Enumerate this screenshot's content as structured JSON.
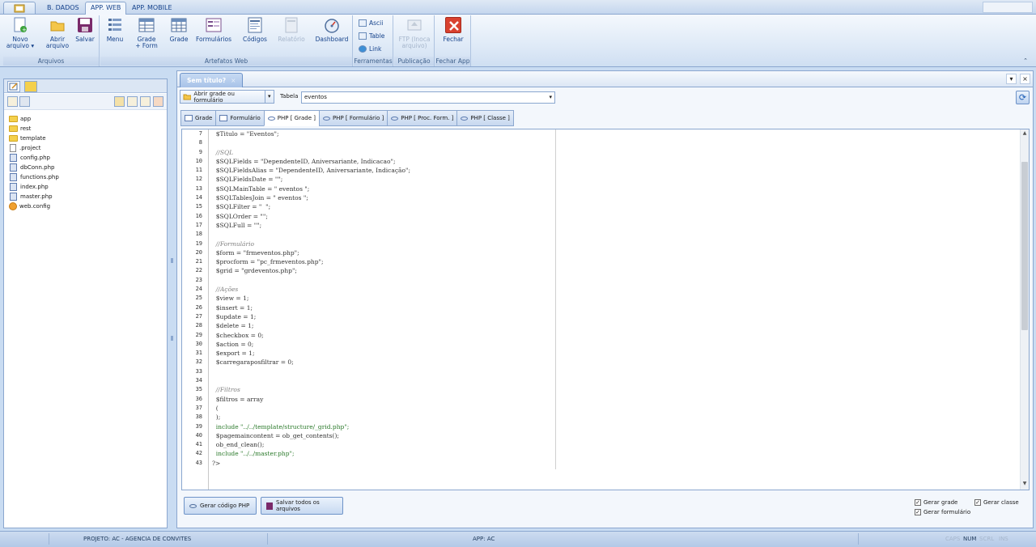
{
  "ribbon_tabs": [
    "B. DADOS",
    "APP. WEB",
    "APP. MOBILE"
  ],
  "active_ribbon_tab": "APP. WEB",
  "groups": {
    "arquivos": {
      "label": "Arquivos",
      "novo": "Novo",
      "novo_sub": "arquivo ▾",
      "abrir": "Abrir",
      "abrir_sub": "arquivo",
      "salvar": "Salvar"
    },
    "artefatos": {
      "label": "Artefatos Web",
      "menu": "Menu",
      "grade_form": "Grade",
      "grade_form_sub": "+ Form",
      "grade": "Grade",
      "formularios": "Formulários",
      "codigos": "Códigos",
      "relatorio": "Relatório",
      "dashboard": "Dashboard"
    },
    "ferramentas": {
      "label": "Ferramentas",
      "ascii": "Ascii",
      "table": "Table",
      "link": "Link"
    },
    "publicacao": {
      "label": "Publicação",
      "ftp": "FTP (Inoca",
      "ftp_sub": "arquivo)"
    },
    "fecharapp": {
      "label": "Fechar App",
      "fechar": "Fechar"
    }
  },
  "files": [
    {
      "name": "app",
      "type": "folder"
    },
    {
      "name": "rest",
      "type": "folder"
    },
    {
      "name": "template",
      "type": "folder"
    },
    {
      "name": ".project",
      "type": "file"
    },
    {
      "name": "config.php",
      "type": "php"
    },
    {
      "name": "dbConn.php",
      "type": "php"
    },
    {
      "name": "functions.php",
      "type": "php"
    },
    {
      "name": "index.php",
      "type": "php"
    },
    {
      "name": "master.php",
      "type": "php"
    },
    {
      "name": "web.config",
      "type": "config"
    }
  ],
  "document": {
    "tab_title": "Sem título?",
    "tab_close": "×",
    "grid_select": "Abrir grade ou formulário",
    "table_label": "Tabela",
    "table_value": "eventos",
    "subtabs": [
      "Grade",
      "Formulário",
      "PHP [ Grade ]",
      "PHP [ Formulário ]",
      "PHP [ Proc. Form. ]",
      "PHP [ Classe ]"
    ],
    "active_subtab": "PHP [ Grade ]"
  },
  "code": {
    "line_numbers": [
      "7",
      "8",
      "9",
      "10",
      "11",
      "12",
      "13",
      "14",
      "15",
      "16",
      "17",
      "18",
      "19",
      "20",
      "21",
      "22",
      "23",
      "24",
      "25",
      "26",
      "27",
      "28",
      "29",
      "30",
      "31",
      "32",
      "33",
      "34",
      "35",
      "36",
      "37",
      "38",
      "39",
      "40",
      "41",
      "42",
      "43"
    ],
    "lines": [
      "  $Titulo = \"Eventos\";",
      "",
      "  //SQL",
      "  $SQLFields = \"DependenteID, Aniversariante, Indicacao\";",
      "  $SQLFieldsAlias = \"DependenteID, Aniversariante, Indicação\";",
      "  $SQLFieldsDate = \"\";",
      "  $SQLMainTable = \" eventos \";",
      "  $SQLTablesJoin = \" eventos \";",
      "  $SQLFilter = \"  \";",
      "  $SQLOrder = \"\";",
      "  $SQLFull = \"\";",
      "",
      "  //Formulário",
      "  $form = \"frmeventos.php\";",
      "  $procform = \"pc_frmeventos.php\";",
      "  $grid = \"grdeventos.php\";",
      "",
      "  //Ações",
      "  $view = 1;",
      "  $insert = 1;",
      "  $update = 1;",
      "  $delete = 1;",
      "  $checkbox = 0;",
      "  $action = 0;",
      "  $export = 1;",
      "  $carregaraposfiltrar = 0;",
      "",
      "",
      "  //Filtros",
      "  $filtros = array",
      "  (",
      "  );",
      "  include \"../../template/structure/_grid.php\";",
      "  $pagemaincontent = ob_get_contents();",
      "  ob_end_clean();",
      "  include \"../../master.php\";",
      "?>"
    ]
  },
  "bottom": {
    "gerar_codigo": "Gerar código PHP",
    "salvar_todos": "Salvar todos os arquivos",
    "gerar_grade": "Gerar grade",
    "gerar_classe": "Gerar classe",
    "gerar_formulario": "Gerar formulário"
  },
  "status": {
    "projeto": "PROJETO: AC - AGENCIA DE CONVITES",
    "app": "APP: AC",
    "caps": "CAPS",
    "num": "NUM",
    "scrl": "SCRL",
    "ins": "INS"
  },
  "colors": {
    "accent": "#15428b",
    "ribbon_bg": "#dfeaf7",
    "code_comment": "#808080",
    "code_string": "#a31515",
    "code_number": "#a31515",
    "code_var": "#1a1a1a"
  }
}
